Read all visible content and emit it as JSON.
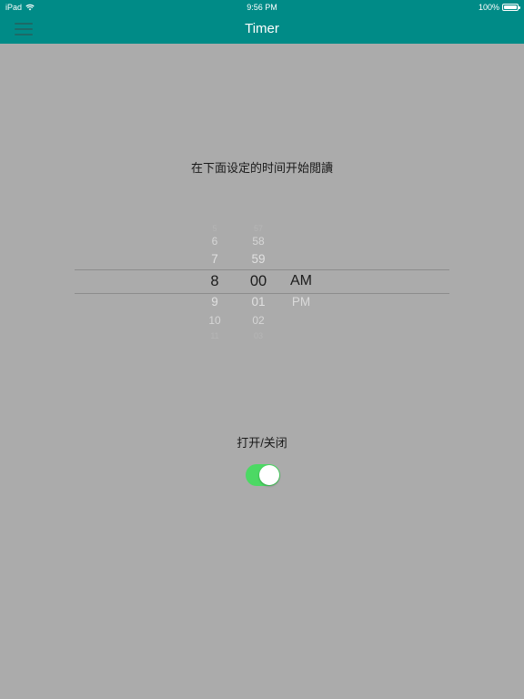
{
  "status_bar": {
    "device": "iPad",
    "time": "9:56 PM",
    "battery": "100%"
  },
  "nav": {
    "title": "Timer",
    "menu_icon": "hamburger-menu-icon"
  },
  "instruction": "在下面设定的时间开始閲讀",
  "picker": {
    "hours": {
      "before": [
        "5",
        "6",
        "7"
      ],
      "selected": "8",
      "after": [
        "9",
        "10",
        "11"
      ]
    },
    "minutes": {
      "before": [
        "57",
        "58",
        "59"
      ],
      "selected": "00",
      "after": [
        "01",
        "02",
        "03"
      ]
    },
    "ampm": {
      "selected": "AM",
      "other": "PM"
    }
  },
  "toggle": {
    "label": "打开/关闭",
    "on": true,
    "on_color": "#4cd964"
  },
  "colors": {
    "header": "#008b87",
    "background": "#ababab"
  }
}
